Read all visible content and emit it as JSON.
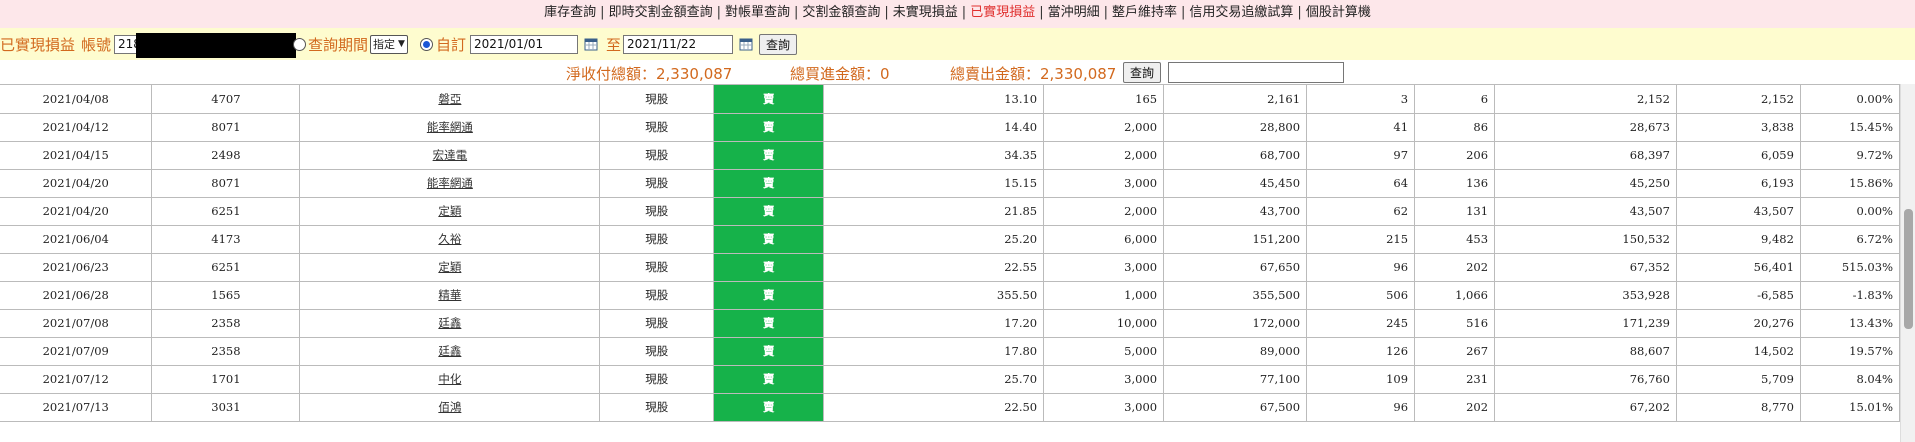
{
  "nav": {
    "items": [
      {
        "label": "庫存查詢",
        "active": false
      },
      {
        "label": "即時交割金額查詢",
        "active": false
      },
      {
        "label": "對帳單查詢",
        "active": false
      },
      {
        "label": "交割金額查詢",
        "active": false
      },
      {
        "label": "未實現損益",
        "active": false
      },
      {
        "label": "已實現損益",
        "active": true
      },
      {
        "label": "當沖明細",
        "active": false
      },
      {
        "label": "整戶維持率",
        "active": false
      },
      {
        "label": "信用交易追繳試算",
        "active": false
      },
      {
        "label": "個股計算機",
        "active": false
      }
    ],
    "separator": "|"
  },
  "filter": {
    "title": "已實現損益",
    "account_label": "帳號",
    "account_value": "218",
    "period_label": "查詢期間",
    "period_select": "指定",
    "custom_label": "自訂",
    "date_from": "2021/01/01",
    "to_label": "至",
    "date_to": "2021/11/22",
    "query_button": "查詢"
  },
  "summary": {
    "net_label": "淨收付總額：2,330,087",
    "buy_label": "總買進金額：0",
    "sell_label": "總賣出金額：2,330,087",
    "query_button": "查詢",
    "search_value": ""
  },
  "table": {
    "rows": [
      [
        "2021/04/08",
        "4707",
        "磐亞",
        "現股",
        "賣",
        "13.10",
        "165",
        "2,161",
        "3",
        "6",
        "2,152",
        "2,152",
        "0.00%"
      ],
      [
        "2021/04/12",
        "8071",
        "能率網通",
        "現股",
        "賣",
        "14.40",
        "2,000",
        "28,800",
        "41",
        "86",
        "28,673",
        "3,838",
        "15.45%"
      ],
      [
        "2021/04/15",
        "2498",
        "宏達電",
        "現股",
        "賣",
        "34.35",
        "2,000",
        "68,700",
        "97",
        "206",
        "68,397",
        "6,059",
        "9.72%"
      ],
      [
        "2021/04/20",
        "8071",
        "能率網通",
        "現股",
        "賣",
        "15.15",
        "3,000",
        "45,450",
        "64",
        "136",
        "45,250",
        "6,193",
        "15.86%"
      ],
      [
        "2021/04/20",
        "6251",
        "定穎",
        "現股",
        "賣",
        "21.85",
        "2,000",
        "43,700",
        "62",
        "131",
        "43,507",
        "43,507",
        "0.00%"
      ],
      [
        "2021/06/04",
        "4173",
        "久裕",
        "現股",
        "賣",
        "25.20",
        "6,000",
        "151,200",
        "215",
        "453",
        "150,532",
        "9,482",
        "6.72%"
      ],
      [
        "2021/06/23",
        "6251",
        "定穎",
        "現股",
        "賣",
        "22.55",
        "3,000",
        "67,650",
        "96",
        "202",
        "67,352",
        "56,401",
        "515.03%"
      ],
      [
        "2021/06/28",
        "1565",
        "精華",
        "現股",
        "賣",
        "355.50",
        "1,000",
        "355,500",
        "506",
        "1,066",
        "353,928",
        "-6,585",
        "-1.83%"
      ],
      [
        "2021/07/08",
        "2358",
        "廷鑫",
        "現股",
        "賣",
        "17.20",
        "10,000",
        "172,000",
        "245",
        "516",
        "171,239",
        "20,276",
        "13.43%"
      ],
      [
        "2021/07/09",
        "2358",
        "廷鑫",
        "現股",
        "賣",
        "17.80",
        "5,000",
        "89,000",
        "126",
        "267",
        "88,607",
        "14,502",
        "19.57%"
      ],
      [
        "2021/07/12",
        "1701",
        "中化",
        "現股",
        "賣",
        "25.70",
        "3,000",
        "77,100",
        "109",
        "231",
        "76,760",
        "5,709",
        "8.04%"
      ],
      [
        "2021/07/13",
        "3031",
        "佰鴻",
        "現股",
        "賣",
        "22.50",
        "3,000",
        "67,500",
        "96",
        "202",
        "67,202",
        "8,770",
        "15.01%"
      ]
    ]
  },
  "colors": {
    "nav_bg": "#fde7ea",
    "active_nav": "#e0302f",
    "filter_bg": "#fefccf",
    "accent_orange": "#d2691e",
    "sell_cell": "#16b24a"
  },
  "icons": [
    "calendar-icon",
    "calendar-icon"
  ]
}
